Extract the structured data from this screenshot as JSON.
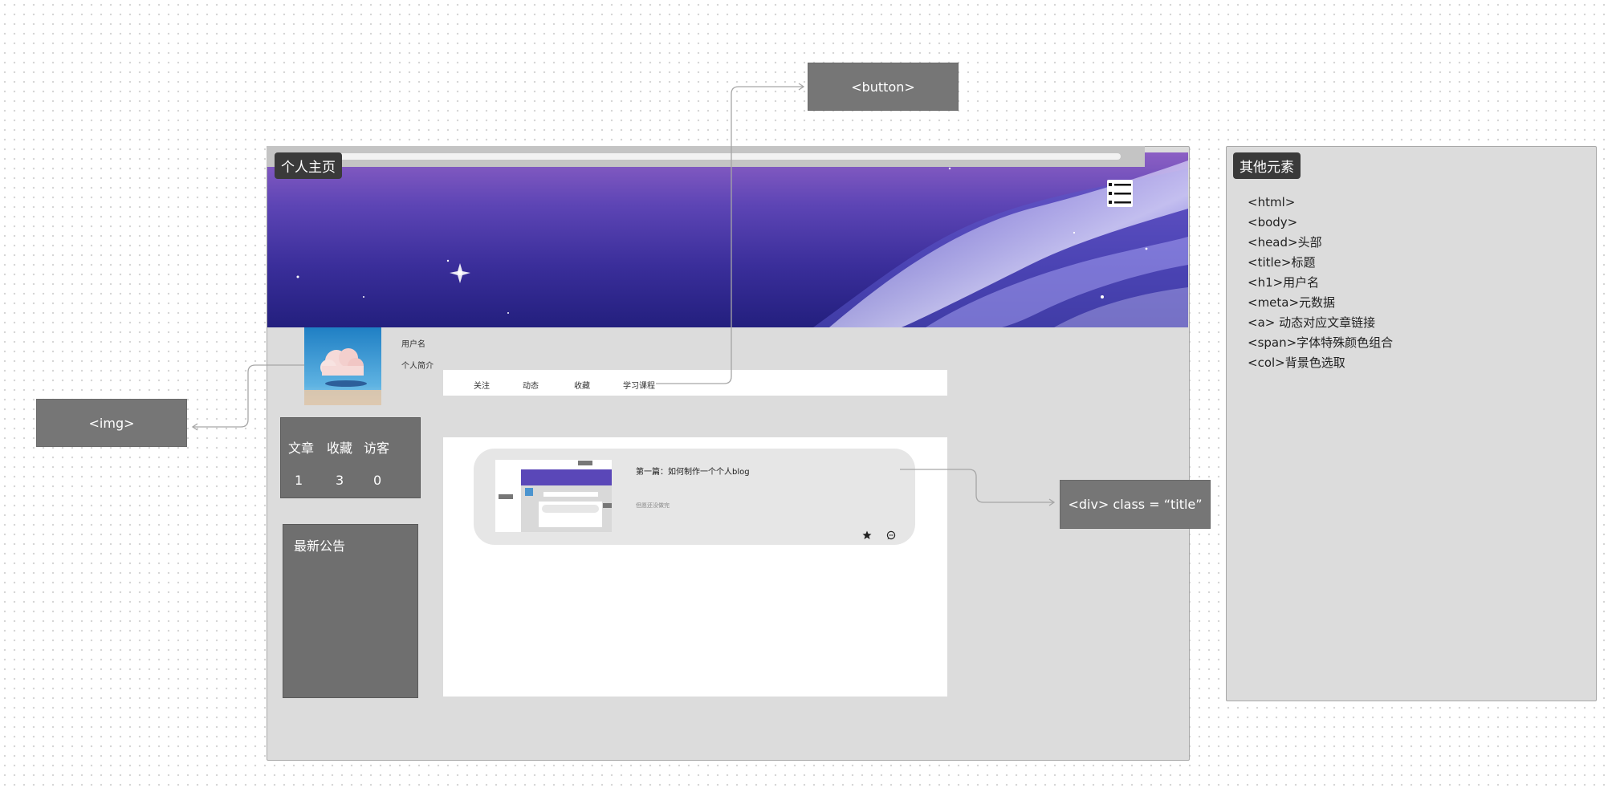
{
  "page_label": "个人主页",
  "profile": {
    "username": "用户名",
    "intro": "个人简介"
  },
  "nav": {
    "items": [
      {
        "label": "关注"
      },
      {
        "label": "动态"
      },
      {
        "label": "收藏"
      },
      {
        "label": "学习课程"
      }
    ]
  },
  "stats": {
    "labels": [
      "文章",
      "收藏",
      "访客"
    ],
    "values": [
      "1",
      "3",
      "0"
    ]
  },
  "notice": {
    "title": "最新公告"
  },
  "post": {
    "title": "第一篇：如何制作一个个人blog",
    "subtitle": "但愿还没做完"
  },
  "annotations": {
    "button": "<button>",
    "img": "<img>",
    "title_div": "<div> class = “title”"
  },
  "other_elements": {
    "title": "其他元素",
    "items": [
      "<html>",
      "<body>",
      "<head>头部",
      "<title>标题",
      "<h1>用户名",
      "<meta>元数据",
      "<a> 动态对应文章链接",
      "<span>字体特殊颜色组合",
      "<col>背景色选取"
    ]
  },
  "colors": {
    "frame_bg": "#dcdcdc",
    "annotation_box": "#767676",
    "tag_bg": "#3a3a3a",
    "banner_top": "#8c5fc4",
    "banner_bottom": "#231f7e"
  }
}
